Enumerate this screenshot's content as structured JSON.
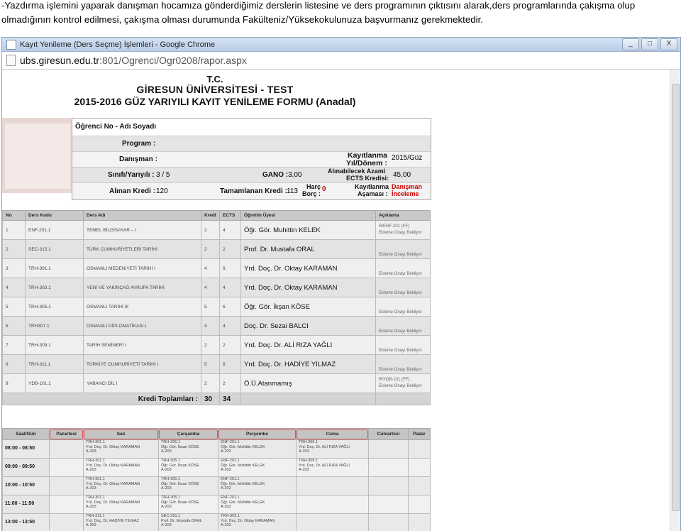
{
  "instruction": "-Yazdırma işlemini yaparak danışman hocamıza gönderdiğimiz derslerin listesine ve ders programının çıktısını alarak,ders programlarında çakışma olup olmadığının kontrol edilmesi, çakışma olması durumunda Fakülteniz/Yüksekokulunuza başvurmanız gerekmektedir.",
  "window": {
    "title": "Kayıt Yenileme (Ders Seçme) İşlemleri - Google Chrome",
    "url_host": "ubs.giresun.edu.tr",
    "url_path": ":801/Ogrenci/Ogr0208/rapor.aspx",
    "buttons": {
      "minimize": "_",
      "maximize": "□",
      "close": "X"
    }
  },
  "form": {
    "header1": "T.C.",
    "header2": "GİRESUN ÜNİVERSİTESİ - TEST",
    "header3": "2015-2016 GÜZ YARIYILI KAYIT YENİLEME FORMU (Anadal)",
    "labels": {
      "student": "Öğrenci No - Adı Soyadı",
      "program": "Program :",
      "advisor": "Danışman :",
      "class": "Sınıfı/Yarıyılı :",
      "class_value": "3 / 5",
      "gano": "GANO :",
      "gano_value": "3,00",
      "term_l1": "Kayıtlanma",
      "term_l2": "Yıl/Dönem :",
      "term_value": "2015/Güz",
      "ects_l1": "Alınabilecek Azami",
      "ects_l2": "ECTS Kredisi:",
      "ects_value": "45,00",
      "credits_taken": "Alınan Kredi :",
      "credits_taken_value": "120",
      "credits_done": "Tamamlanan Kredi :",
      "credits_done_value": "113",
      "fee_l1": "Harç",
      "fee_l2": "Borç :",
      "fee_value": "0",
      "stage_l1": "Kayıtlanma",
      "stage_l2": "Aşaması :",
      "stage_v1": "Danışman",
      "stage_v2": "İnceleme"
    }
  },
  "courses": {
    "headers": [
      "No",
      "Ders Kodu",
      "Ders Adı",
      "Kredi",
      "ECTS",
      "Öğretim Üyesi",
      "Açıklama"
    ],
    "rows": [
      {
        "no": "1",
        "code": "ENF-201.1",
        "name": "TEMEL BİLGİSAYAR – I",
        "credit": "2",
        "ects": "4",
        "teacher": "Öğr. Gör. Muhittin KELEK",
        "note1": "R/ENF-201 (FF)",
        "note2": "Ekleme Onayı Bekliyor"
      },
      {
        "no": "2",
        "code": "SEC-315.1",
        "name": "TÜRK CUMHURİYETLERİ TARİHİ",
        "credit": "2",
        "ects": "2",
        "teacher": "Prof. Dr. Mustafa ORAL",
        "note1": "",
        "note2": "Ekleme Onayı Bekliyor"
      },
      {
        "no": "3",
        "code": "TRH-301.1",
        "name": "OSMANLI MEDENİYETİ TARİHİ I",
        "credit": "4",
        "ects": "6",
        "teacher": "Yrd. Doç. Dr. Oktay KARAMAN",
        "note1": "",
        "note2": "Ekleme Onayı Bekliyor"
      },
      {
        "no": "4",
        "code": "TRH-303.1",
        "name": "YENİ VE YAKINÇAĞ AVRUPA TARİHİ",
        "credit": "4",
        "ects": "4",
        "teacher": "Yrd. Doç. Dr. Oktay KARAMAN",
        "note1": "",
        "note2": "Ekleme Onayı Bekliyor"
      },
      {
        "no": "5",
        "code": "TRH-305.1",
        "name": "OSMANLI TARİHİ III",
        "credit": "5",
        "ects": "6",
        "teacher": "Öğr. Gör. İkşan KÖSE",
        "note1": "",
        "note2": "Ekleme Onayı Bekliyor"
      },
      {
        "no": "6",
        "code": "TRH307.1",
        "name": "OSMANLI DİPLOMATİKASI-I",
        "credit": "4",
        "ects": "4",
        "teacher": "Doç. Dr. Sezai BALCI",
        "note1": "",
        "note2": "Ekleme Onayı Bekliyor"
      },
      {
        "no": "7",
        "code": "TRH-309.1",
        "name": "TARİH SEMİNERİ I",
        "credit": "2",
        "ects": "2",
        "teacher": "Yrd. Doç. Dr. ALİ RIZA YAĞLI",
        "note1": "",
        "note2": "Ekleme Onayı Bekliyor"
      },
      {
        "no": "8",
        "code": "TRH-311.1",
        "name": "TÜRKİYE CUMHURİYETİ TARİHİ I",
        "credit": "5",
        "ects": "6",
        "teacher": "Yrd. Doç. Dr. HADİYE YILMAZ",
        "note1": "",
        "note2": "Ekleme Onayı Bekliyor"
      },
      {
        "no": "9",
        "code": "YDB-101.1",
        "name": "YABANCI DİL I",
        "credit": "2",
        "ects": "2",
        "teacher": "Ö.Ü.Atanmamış",
        "note1": "R/YDB-101 (FF)",
        "note2": "Ekleme Onayı Bekliyor"
      }
    ],
    "total_label": "Kredi Toplamları :",
    "total_credit": "30",
    "total_ects": "34"
  },
  "schedule": {
    "headers": [
      "Saat/Gün",
      "Pazartesi",
      "Salı",
      "Çarşamba",
      "Perşembe",
      "Cuma",
      "Cumartesi",
      "Pazar"
    ],
    "rows": [
      {
        "time": "08:00 - 08:50",
        "cells": [
          "",
          "TRH-301.1|Yrd. Doç. Dr. Oktay KARAMAN|A-203",
          "TRH-305.1|Öğr. Gör. İksan KÖSE|A-203",
          "ENF-201.1|Öğr. Gör. Muhittin KELEK|A-202",
          "TRH-309.1|Yrd. Doç. Dr. ALİ RIZA YAĞLI|A-203",
          "",
          ""
        ]
      },
      {
        "time": "09:00 - 09:50",
        "cells": [
          "",
          "TRH-301.1|Yrd. Doç. Dr. Oktay KARAMAN|A-203",
          "TRH-305.1|Öğr. Gör. İksan KÖSE|A-203",
          "ENF-201.1|Öğr. Gör. Muhittin KELEK|A-202",
          "TRH-309.1|Yrd. Doç. Dr. ALİ RIZA YAĞLI|A-203",
          "",
          ""
        ]
      },
      {
        "time": "10:00 - 10:50",
        "cells": [
          "",
          "TRH-301.1|Yrd. Doç. Dr. Oktay KARAMAN|A-203",
          "TRH-305.1|Öğr. Gör. İksan KÖSE|A-203",
          "ENF-201.1|Öğr. Gör. Muhittin KELEK|A-202",
          "",
          "",
          ""
        ]
      },
      {
        "time": "11:00 - 11:50",
        "cells": [
          "",
          "TRH-301.1|Yrd. Doç. Dr. Oktay KARAMAN|A-203",
          "TRH-305.1|Öğr. Gör. İksan KÖSE|A-203",
          "ENF-201.1|Öğr. Gör. Muhittin KELEK|A-202",
          "",
          "",
          ""
        ]
      },
      {
        "time": "13:00 - 13:50",
        "cells": [
          "",
          "TRH-311.1|Yrd. Doç. Dr. HADİYE YILMAZ|A-203",
          "SEC-315.1|Prof. Dr. Mustafa ORAL|A-203",
          "TRH-303.1|Yrd. Doç. Dr. Oktay KARAMAN|A-203",
          "",
          "",
          ""
        ]
      }
    ]
  }
}
